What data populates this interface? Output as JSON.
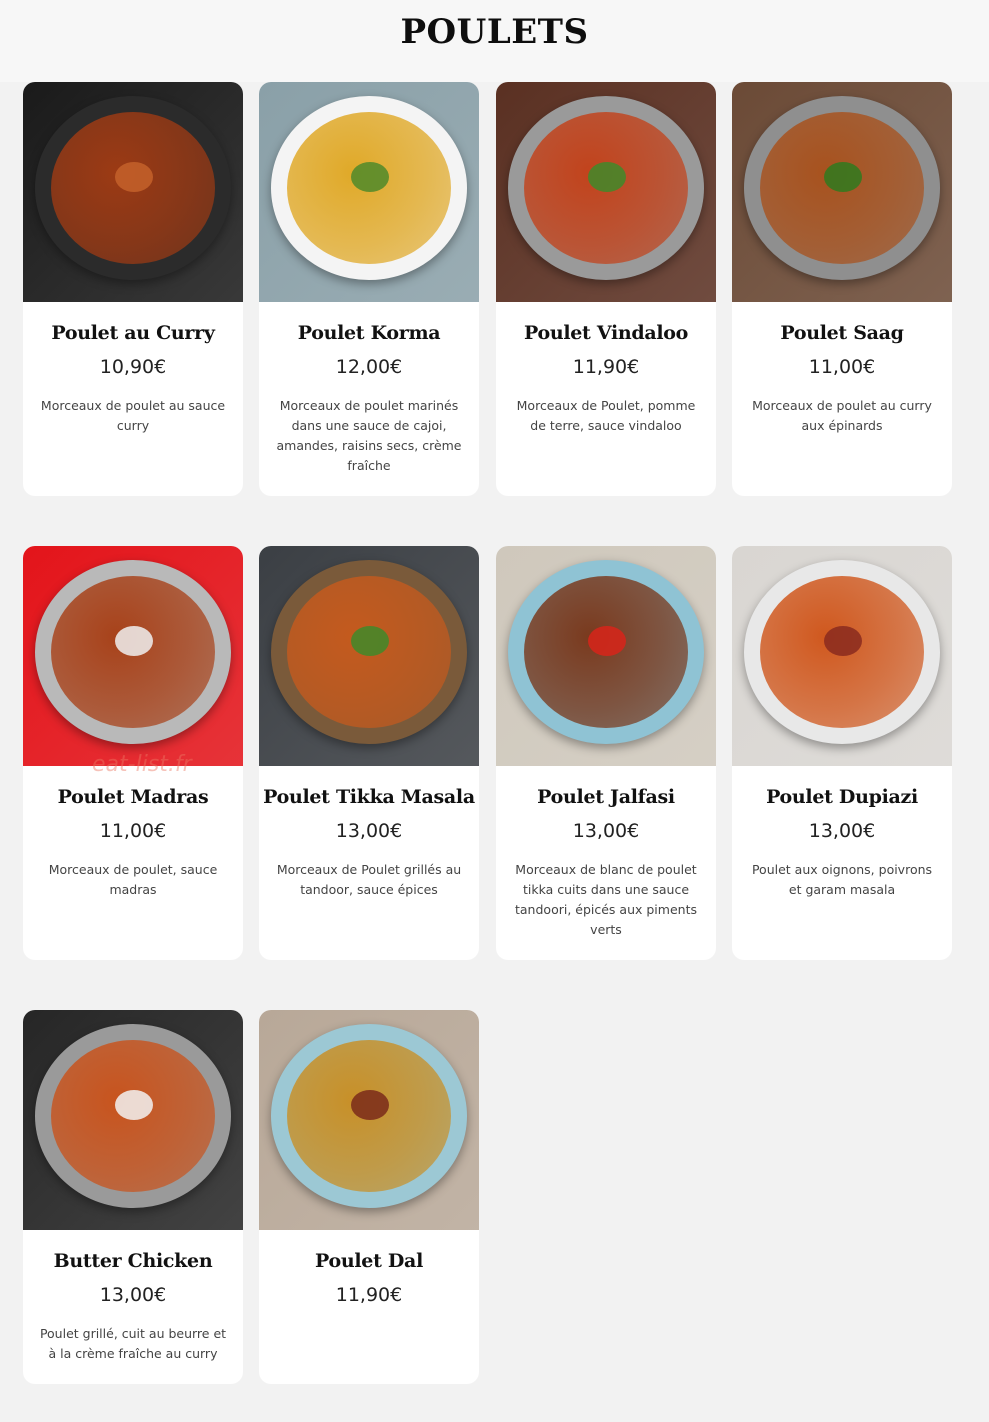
{
  "page": {
    "title": "POULETS",
    "watermark": "eat-list.fr"
  },
  "colors": {
    "background": "#f2f2f2",
    "card": "#ffffff",
    "text": "#111111"
  },
  "dishes": [
    {
      "name": "Poulet au Curry",
      "price": "10,90€",
      "description": "Morceaux de poulet au sauce curry",
      "photo": {
        "bg": "#1a1a1a",
        "plate": "#2b2b2b",
        "food": "#9c3a14",
        "garnish": "#c4622a"
      }
    },
    {
      "name": "Poulet Korma",
      "price": "12,00€",
      "description": "Morceaux de poulet marinés dans une sauce de cajoi, amandes, raisins secs, crème fraîche",
      "photo": {
        "bg": "#8aa0a8",
        "plate": "#f4f4f4",
        "food": "#e0a928",
        "garnish": "#4f8a2a"
      }
    },
    {
      "name": "Poulet Vindaloo",
      "price": "11,90€",
      "description": "Morceaux de Poulet, pomme de terre, sauce vindaloo",
      "photo": {
        "bg": "#5a3022",
        "plate": "#9a9a9a",
        "food": "#c2431c",
        "garnish": "#3f8a2a"
      }
    },
    {
      "name": "Poulet Saag",
      "price": "11,00€",
      "description": "Morceaux de poulet au curry aux épinards",
      "photo": {
        "bg": "#6b4a36",
        "plate": "#8f8f8f",
        "food": "#a8521e",
        "garnish": "#2f7a1e"
      }
    },
    {
      "name": "Poulet Madras",
      "price": "11,00€",
      "description": "Morceaux de poulet, sauce madras",
      "photo": {
        "bg": "#e3141a",
        "plate": "#b9b9b9",
        "food": "#a8421a",
        "garnish": "#f0f0f0"
      }
    },
    {
      "name": "Poulet Tikka Masala",
      "price": "13,00€",
      "description": "Morceaux de Poulet grillés au tandoor, sauce épices",
      "photo": {
        "bg": "#3b3f44",
        "plate": "#7a5a3a",
        "food": "#c45a1e",
        "garnish": "#3f8a2a"
      }
    },
    {
      "name": "Poulet Jalfasi",
      "price": "13,00€",
      "description": "Morceaux de blanc de poulet tikka cuits dans une sauce tandoori, épicés aux piments verts",
      "photo": {
        "bg": "#cfc8bc",
        "plate": "#8fc3d4",
        "food": "#7a3a1e",
        "garnish": "#d8241a"
      }
    },
    {
      "name": "Poulet Dupiazi",
      "price": "13,00€",
      "description": "Poulet aux oignons, poivrons et garam masala",
      "photo": {
        "bg": "#d9d6d2",
        "plate": "#e8e8e8",
        "food": "#d0581e",
        "garnish": "#8a2a1e"
      }
    },
    {
      "name": "Butter Chicken",
      "price": "13,00€",
      "description": "Poulet grillé, cuit au beurre et à la crème fraîche au curry",
      "photo": {
        "bg": "#262626",
        "plate": "#9a9a9a",
        "food": "#c8541e",
        "garnish": "#f2f2f2"
      }
    },
    {
      "name": "Poulet Dal",
      "price": "11,90€",
      "description": "",
      "photo": {
        "bg": "#b8a898",
        "plate": "#9cc8d4",
        "food": "#c89028",
        "garnish": "#7a2a1a"
      }
    }
  ]
}
